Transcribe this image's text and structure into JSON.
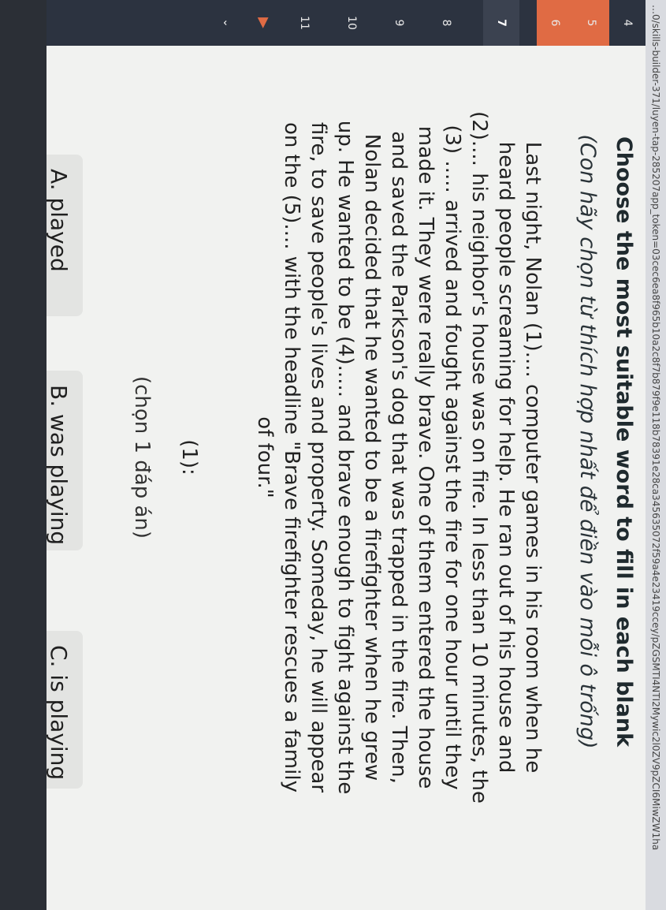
{
  "url": "…0/skills-builder-371/luyen-tap-285207app_token=03cec6ea8f965b10a2c8f7b879f9e118b78391e28ca345635072f59a4e23419ccey/pZGSMTI4NTI2Mywic2l0ZV9pZCI6MiwZW1ha",
  "rail": {
    "items": [
      {
        "label": "4"
      },
      {
        "label": "5"
      },
      {
        "label": "6"
      },
      {
        "label": "7"
      },
      {
        "label": "8"
      },
      {
        "label": "9"
      },
      {
        "label": "10"
      },
      {
        "label": "11"
      }
    ]
  },
  "instruction": {
    "title": "Choose the most suitable word to fill in each blank",
    "subtitle": "(Con hãy chọn từ thích hợp nhất để điền vào mỗi ô trống)"
  },
  "passage": {
    "lines": [
      "Last night, Nolan (1).... computer games in his room when he",
      "heard people screaming for help. He ran out of his house and",
      "(2).... his neighbor's house was on fire. In less than 10 minutes, the",
      "(3) ..... arrived and fought against the fire for one hour until they",
      "made it. They were really brave. One of them entered the house",
      "and saved the Parkson's dog that was trapped in the fire. Then,",
      "Nolan decided that he wanted to be a firefighter when he grew",
      "up. He wanted to be (4)..... and brave enough to fight against the",
      "fire, to save people's lives and property. Someday, he will appear",
      "on the (5).... with the headline \"Brave firefighter rescues a family",
      "of four.\""
    ]
  },
  "question": {
    "label": "(1):",
    "hint": "(chọn 1 đáp án)"
  },
  "options": [
    {
      "label": "A. played"
    },
    {
      "label": "B. was playing"
    },
    {
      "label": "C. is playing"
    }
  ]
}
